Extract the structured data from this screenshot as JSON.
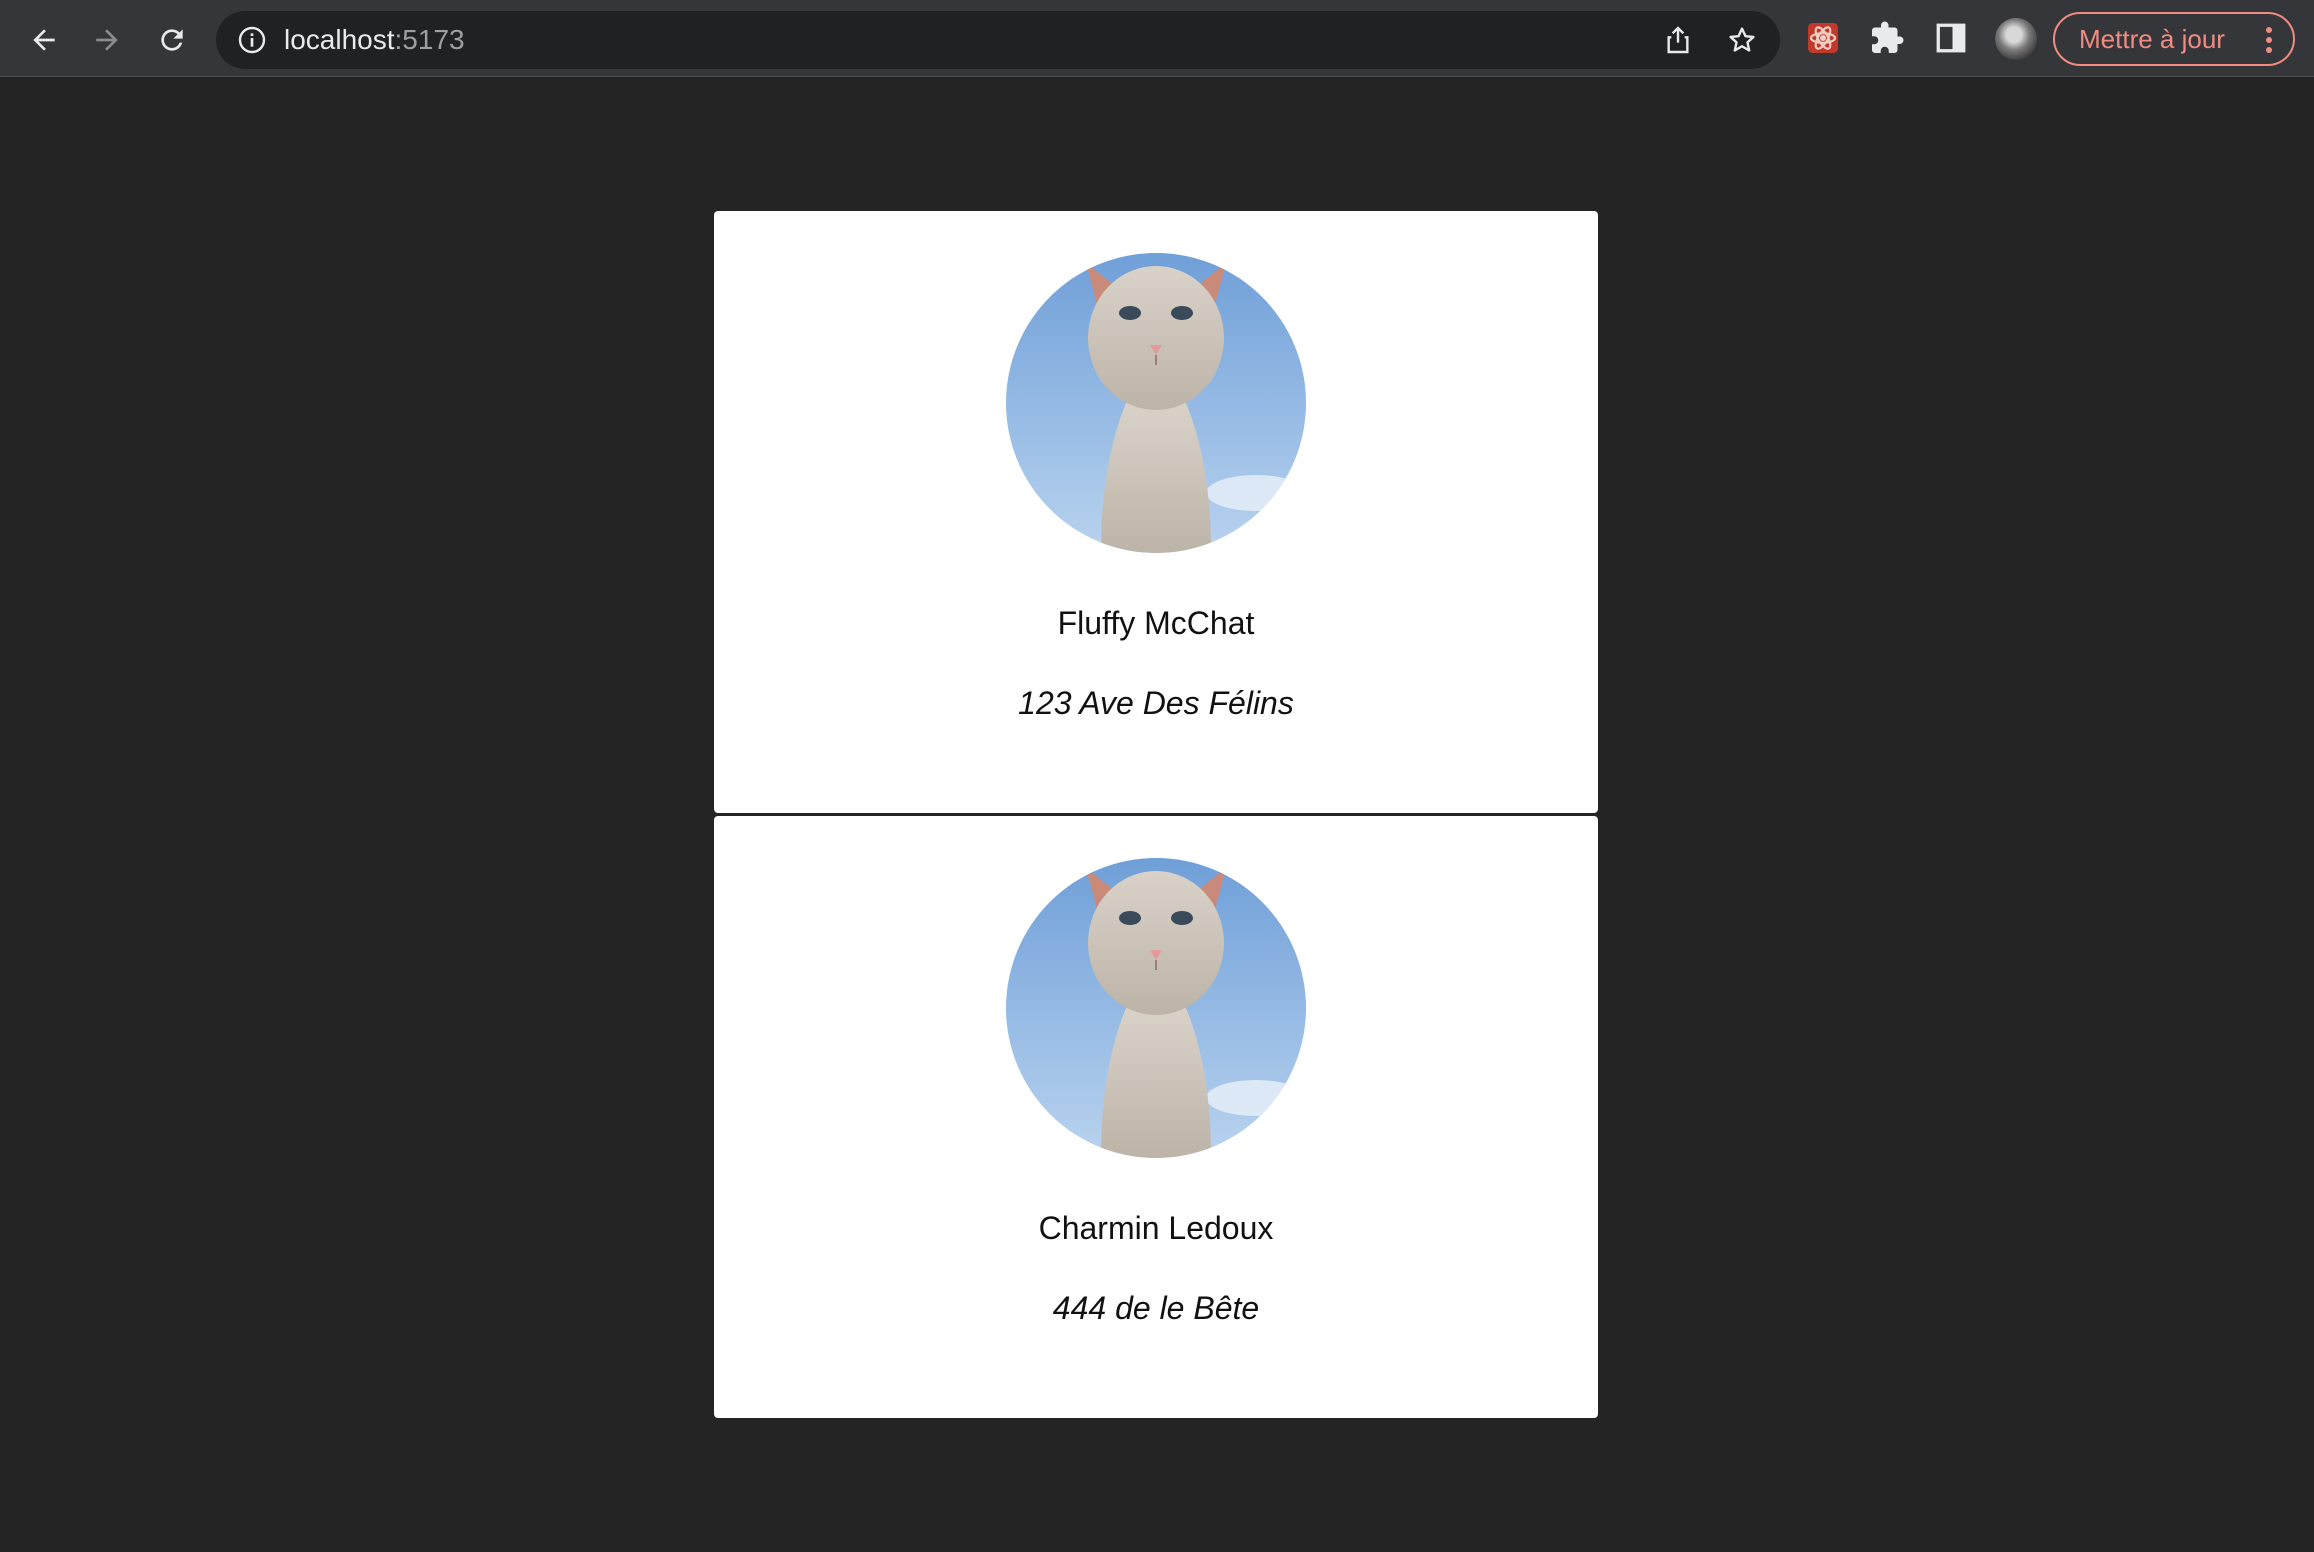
{
  "browser": {
    "url_host": "localhost",
    "url_port": ":5173",
    "update_button_label": "Mettre à jour",
    "icons": [
      "back-icon",
      "forward-icon",
      "reload-icon",
      "info-icon",
      "share-icon",
      "bookmark-star-icon",
      "extension-icon",
      "puzzle-icon",
      "side-panel-icon",
      "profile-avatar",
      "more-vert-icon"
    ],
    "accent_color": "#f28b82"
  },
  "cards": [
    {
      "name": "Fluffy McChat",
      "address": "123 Ave Des Félins"
    },
    {
      "name": "Charmin Ledoux",
      "address": "444 de le Bête"
    }
  ],
  "colors": {
    "page_background": "#242424",
    "card_background": "#ffffff",
    "toolbar_background": "#35363a"
  }
}
